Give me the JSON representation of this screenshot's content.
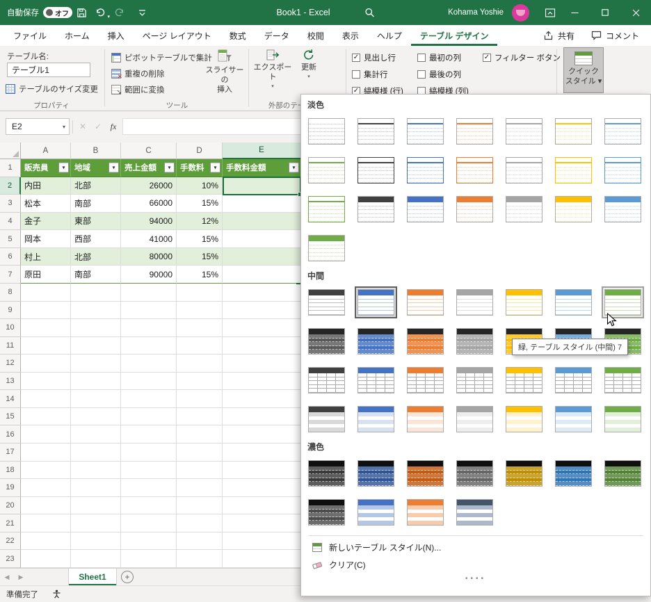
{
  "colors": {
    "excel_green": "#217346",
    "table_header_green": "#5D9E3A",
    "table_band_green": "#E2EFDA",
    "ribbon_bg": "#F3F2F1"
  },
  "titlebar": {
    "autosave_label": "自動保存",
    "autosave_state": "オフ",
    "title": "Book1  -  Excel",
    "user": "Kohama Yoshie"
  },
  "tabs": {
    "file": "ファイル",
    "items": [
      "ホーム",
      "挿入",
      "ページ レイアウト",
      "数式",
      "データ",
      "校閲",
      "表示",
      "ヘルプ",
      "テーブル デザイン"
    ],
    "share": "共有",
    "comments": "コメント"
  },
  "ribbon": {
    "table_name_label": "テーブル名:",
    "table_name": "テーブル1",
    "resize_table": "テーブルのサイズ変更",
    "group1": "プロパティ",
    "pivot": "ピボットテーブルで集計",
    "dedupe": "重複の削除",
    "to_range": "範囲に変換",
    "slicer_line1": "スライサーの",
    "slicer_line2": "挿入",
    "group2": "ツール",
    "export": "エクスポート",
    "refresh": "更新",
    "group3": "外部のテーブ",
    "opt_header_row": "見出し行",
    "opt_total_row": "集計行",
    "opt_banded_rows": "縞模様 (行)",
    "opt_first_col": "最初の列",
    "opt_last_col": "最後の列",
    "opt_banded_cols": "縞模様 (列)",
    "opt_filter": "フィルター ボタン",
    "quick_line1": "クイック",
    "quick_line2": "スタイル"
  },
  "formula": {
    "name_box": "E2"
  },
  "sheet": {
    "columns": [
      "A",
      "B",
      "C",
      "D",
      "E"
    ],
    "row_labels": [
      "1",
      "2",
      "3",
      "4",
      "5",
      "6",
      "7",
      "8",
      "9",
      "10",
      "11",
      "12",
      "13",
      "14",
      "15",
      "16",
      "17",
      "18",
      "19",
      "20",
      "21",
      "22",
      "23"
    ],
    "table": {
      "headers": [
        "販売員",
        "地域",
        "売上金額",
        "手数料",
        "手数料金額"
      ],
      "rows": [
        [
          "内田",
          "北部",
          "26000",
          "10%",
          ""
        ],
        [
          "松本",
          "南部",
          "66000",
          "15%",
          ""
        ],
        [
          "金子",
          "東部",
          "94000",
          "12%",
          ""
        ],
        [
          "岡本",
          "西部",
          "41000",
          "15%",
          ""
        ],
        [
          "村上",
          "北部",
          "80000",
          "15%",
          ""
        ],
        [
          "原田",
          "南部",
          "90000",
          "15%",
          ""
        ]
      ]
    },
    "sheet_tab": "Sheet1",
    "status": "準備完了"
  },
  "gallery": {
    "tooltip": "緑, テーブル スタイル (中間) 7",
    "new_style": "新しいテーブル スタイル(N)...",
    "clear": "クリア(C)",
    "sections": [
      {
        "label": "淡色",
        "items": [
          {
            "n": "none",
            "v": "plain",
            "c": "#BFBFBF"
          },
          {
            "n": "light-1",
            "v": "lines",
            "c": "#404040",
            "l": "#BFBFBF"
          },
          {
            "n": "light-2",
            "v": "lines",
            "c": "#4472C4",
            "l": "#B4C7E7"
          },
          {
            "n": "light-3",
            "v": "lines",
            "c": "#ED7D31",
            "l": "#F8CBAD"
          },
          {
            "n": "light-4",
            "v": "lines",
            "c": "#A5A5A5",
            "l": "#DBDBDB"
          },
          {
            "n": "light-5",
            "v": "lines",
            "c": "#FFC000",
            "l": "#FFE699"
          },
          {
            "n": "light-6",
            "v": "lines",
            "c": "#5B9BD5",
            "l": "#BDD7EE"
          },
          {
            "n": "light-7",
            "v": "lines",
            "c": "#70AD47",
            "l": "#C6E0B4"
          },
          {
            "n": "light-8",
            "v": "boxed",
            "c": "#404040",
            "l": "#BFBFBF"
          },
          {
            "n": "light-9",
            "v": "boxed",
            "c": "#4472C4",
            "l": "#B4C7E7"
          },
          {
            "n": "light-10",
            "v": "boxed",
            "c": "#ED7D31",
            "l": "#F8CBAD"
          },
          {
            "n": "light-11",
            "v": "boxed",
            "c": "#A5A5A5",
            "l": "#DBDBDB"
          },
          {
            "n": "light-12",
            "v": "boxed",
            "c": "#FFC000",
            "l": "#FFE699"
          },
          {
            "n": "light-13",
            "v": "boxed",
            "c": "#5B9BD5",
            "l": "#BDD7EE"
          },
          {
            "n": "light-14",
            "v": "boxed",
            "c": "#70AD47",
            "l": "#C6E0B4"
          },
          {
            "n": "light-15",
            "v": "hfill",
            "c": "#404040",
            "l": "#BFBFBF"
          },
          {
            "n": "light-16",
            "v": "hfill",
            "c": "#4472C4",
            "l": "#B4C7E7"
          },
          {
            "n": "light-17",
            "v": "hfill",
            "c": "#ED7D31",
            "l": "#F8CBAD"
          },
          {
            "n": "light-18",
            "v": "hfill",
            "c": "#A5A5A5",
            "l": "#DBDBDB"
          },
          {
            "n": "light-19",
            "v": "hfill",
            "c": "#FFC000",
            "l": "#FFE699"
          },
          {
            "n": "light-20",
            "v": "hfill",
            "c": "#5B9BD5",
            "l": "#BDD7EE"
          },
          {
            "n": "light-21",
            "v": "hfill",
            "c": "#70AD47",
            "l": "#C6E0B4"
          }
        ]
      },
      {
        "label": "中間",
        "items": [
          {
            "n": "medium-1",
            "v": "mhdr",
            "c": "#404040",
            "l": "#BFBFBF"
          },
          {
            "n": "medium-2",
            "v": "mhdr",
            "c": "#4472C4",
            "l": "#B4C7E7",
            "state": "selected"
          },
          {
            "n": "medium-3",
            "v": "mhdr",
            "c": "#ED7D31",
            "l": "#F8CBAD"
          },
          {
            "n": "medium-4",
            "v": "mhdr",
            "c": "#A5A5A5",
            "l": "#DBDBDB"
          },
          {
            "n": "medium-5",
            "v": "mhdr",
            "c": "#FFC000",
            "l": "#FFE699"
          },
          {
            "n": "medium-6",
            "v": "mhdr",
            "c": "#5B9BD5",
            "l": "#BDD7EE"
          },
          {
            "n": "medium-7",
            "v": "mhdr",
            "c": "#70AD47",
            "l": "#C6E0B4",
            "state": "hovered"
          },
          {
            "n": "medium-8",
            "v": "msolid",
            "c": "#595959"
          },
          {
            "n": "medium-9",
            "v": "msolid",
            "c": "#4472C4"
          },
          {
            "n": "medium-10",
            "v": "msolid",
            "c": "#ED7D31"
          },
          {
            "n": "medium-11",
            "v": "msolid",
            "c": "#A5A5A5"
          },
          {
            "n": "medium-12",
            "v": "msolid",
            "c": "#FFC000"
          },
          {
            "n": "medium-13",
            "v": "msolid",
            "c": "#5B9BD5"
          },
          {
            "n": "medium-14",
            "v": "msolid",
            "c": "#70AD47"
          },
          {
            "n": "medium-15",
            "v": "mgrid",
            "c": "#404040",
            "l": "#BFBFBF"
          },
          {
            "n": "medium-16",
            "v": "mgrid",
            "c": "#4472C4",
            "l": "#B4C7E7"
          },
          {
            "n": "medium-17",
            "v": "mgrid",
            "c": "#ED7D31",
            "l": "#F8CBAD"
          },
          {
            "n": "medium-18",
            "v": "mgrid",
            "c": "#A5A5A5",
            "l": "#DBDBDB"
          },
          {
            "n": "medium-19",
            "v": "mgrid",
            "c": "#FFC000",
            "l": "#FFE699"
          },
          {
            "n": "medium-20",
            "v": "mgrid",
            "c": "#5B9BD5",
            "l": "#BDD7EE"
          },
          {
            "n": "medium-21",
            "v": "mgrid",
            "c": "#70AD47",
            "l": "#C6E0B4"
          },
          {
            "n": "medium-22",
            "v": "mband",
            "c": "#404040",
            "l": "#D9D9D9"
          },
          {
            "n": "medium-23",
            "v": "mband",
            "c": "#4472C4",
            "l": "#D9E2F3"
          },
          {
            "n": "medium-24",
            "v": "mband",
            "c": "#ED7D31",
            "l": "#FBE5D6"
          },
          {
            "n": "medium-25",
            "v": "mband",
            "c": "#A5A5A5",
            "l": "#EDEDED"
          },
          {
            "n": "medium-26",
            "v": "mband",
            "c": "#FFC000",
            "l": "#FFF2CC"
          },
          {
            "n": "medium-27",
            "v": "mband",
            "c": "#5B9BD5",
            "l": "#DEEBF7"
          },
          {
            "n": "medium-28",
            "v": "mband",
            "c": "#70AD47",
            "l": "#E2EFDA"
          }
        ]
      },
      {
        "label": "濃色",
        "items": [
          {
            "n": "dark-1",
            "v": "dark",
            "c": "#3A3A3A"
          },
          {
            "n": "dark-2",
            "v": "dark",
            "c": "#2F5597"
          },
          {
            "n": "dark-3",
            "v": "dark",
            "c": "#C55A11"
          },
          {
            "n": "dark-4",
            "v": "dark",
            "c": "#666666"
          },
          {
            "n": "dark-5",
            "v": "dark",
            "c": "#BF8F00"
          },
          {
            "n": "dark-6",
            "v": "dark",
            "c": "#2E75B6"
          },
          {
            "n": "dark-7",
            "v": "dark",
            "c": "#548235"
          },
          {
            "n": "dark-8",
            "v": "dark",
            "c": "#4D4D4D"
          },
          {
            "n": "dark-9",
            "v": "mband",
            "c": "#4472C4",
            "l": "#B4C7E7"
          },
          {
            "n": "dark-10",
            "v": "mband",
            "c": "#ED7D31",
            "l": "#F8CBAD"
          },
          {
            "n": "dark-11",
            "v": "mband",
            "c": "#44546A",
            "l": "#ACB9CA"
          }
        ]
      }
    ]
  }
}
